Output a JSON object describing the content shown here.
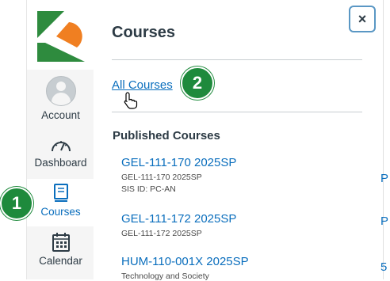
{
  "nav": {
    "items": [
      {
        "label": "Account",
        "icon": "avatar"
      },
      {
        "label": "Dashboard",
        "icon": "dashboard-icon"
      },
      {
        "label": "Courses",
        "icon": "courses-icon",
        "active": true
      },
      {
        "label": "Calendar",
        "icon": "calendar-icon"
      }
    ]
  },
  "tray": {
    "title": "Courses",
    "close_label": "×",
    "all_courses_link": "All Courses",
    "section_title": "Published Courses",
    "courses": [
      {
        "name": "GEL-111-170 2025SP",
        "sub": "GEL-111-170 2025SP",
        "sis": "SIS ID: PC-AN"
      },
      {
        "name": "GEL-111-172 2025SP",
        "sub": "GEL-111-172 2025SP"
      },
      {
        "name": "HUM-110-001X 2025SP",
        "sub": "Technology and Society"
      }
    ]
  },
  "background_edge": {
    "chars": [
      "P",
      "P",
      "5"
    ]
  },
  "badges": {
    "step1": "1",
    "step2": "2"
  },
  "colors": {
    "accent": "#0a6ebd",
    "badge": "#1e8a3c",
    "logo_green": "#2e8b3e",
    "logo_orange": "#f07f21"
  }
}
